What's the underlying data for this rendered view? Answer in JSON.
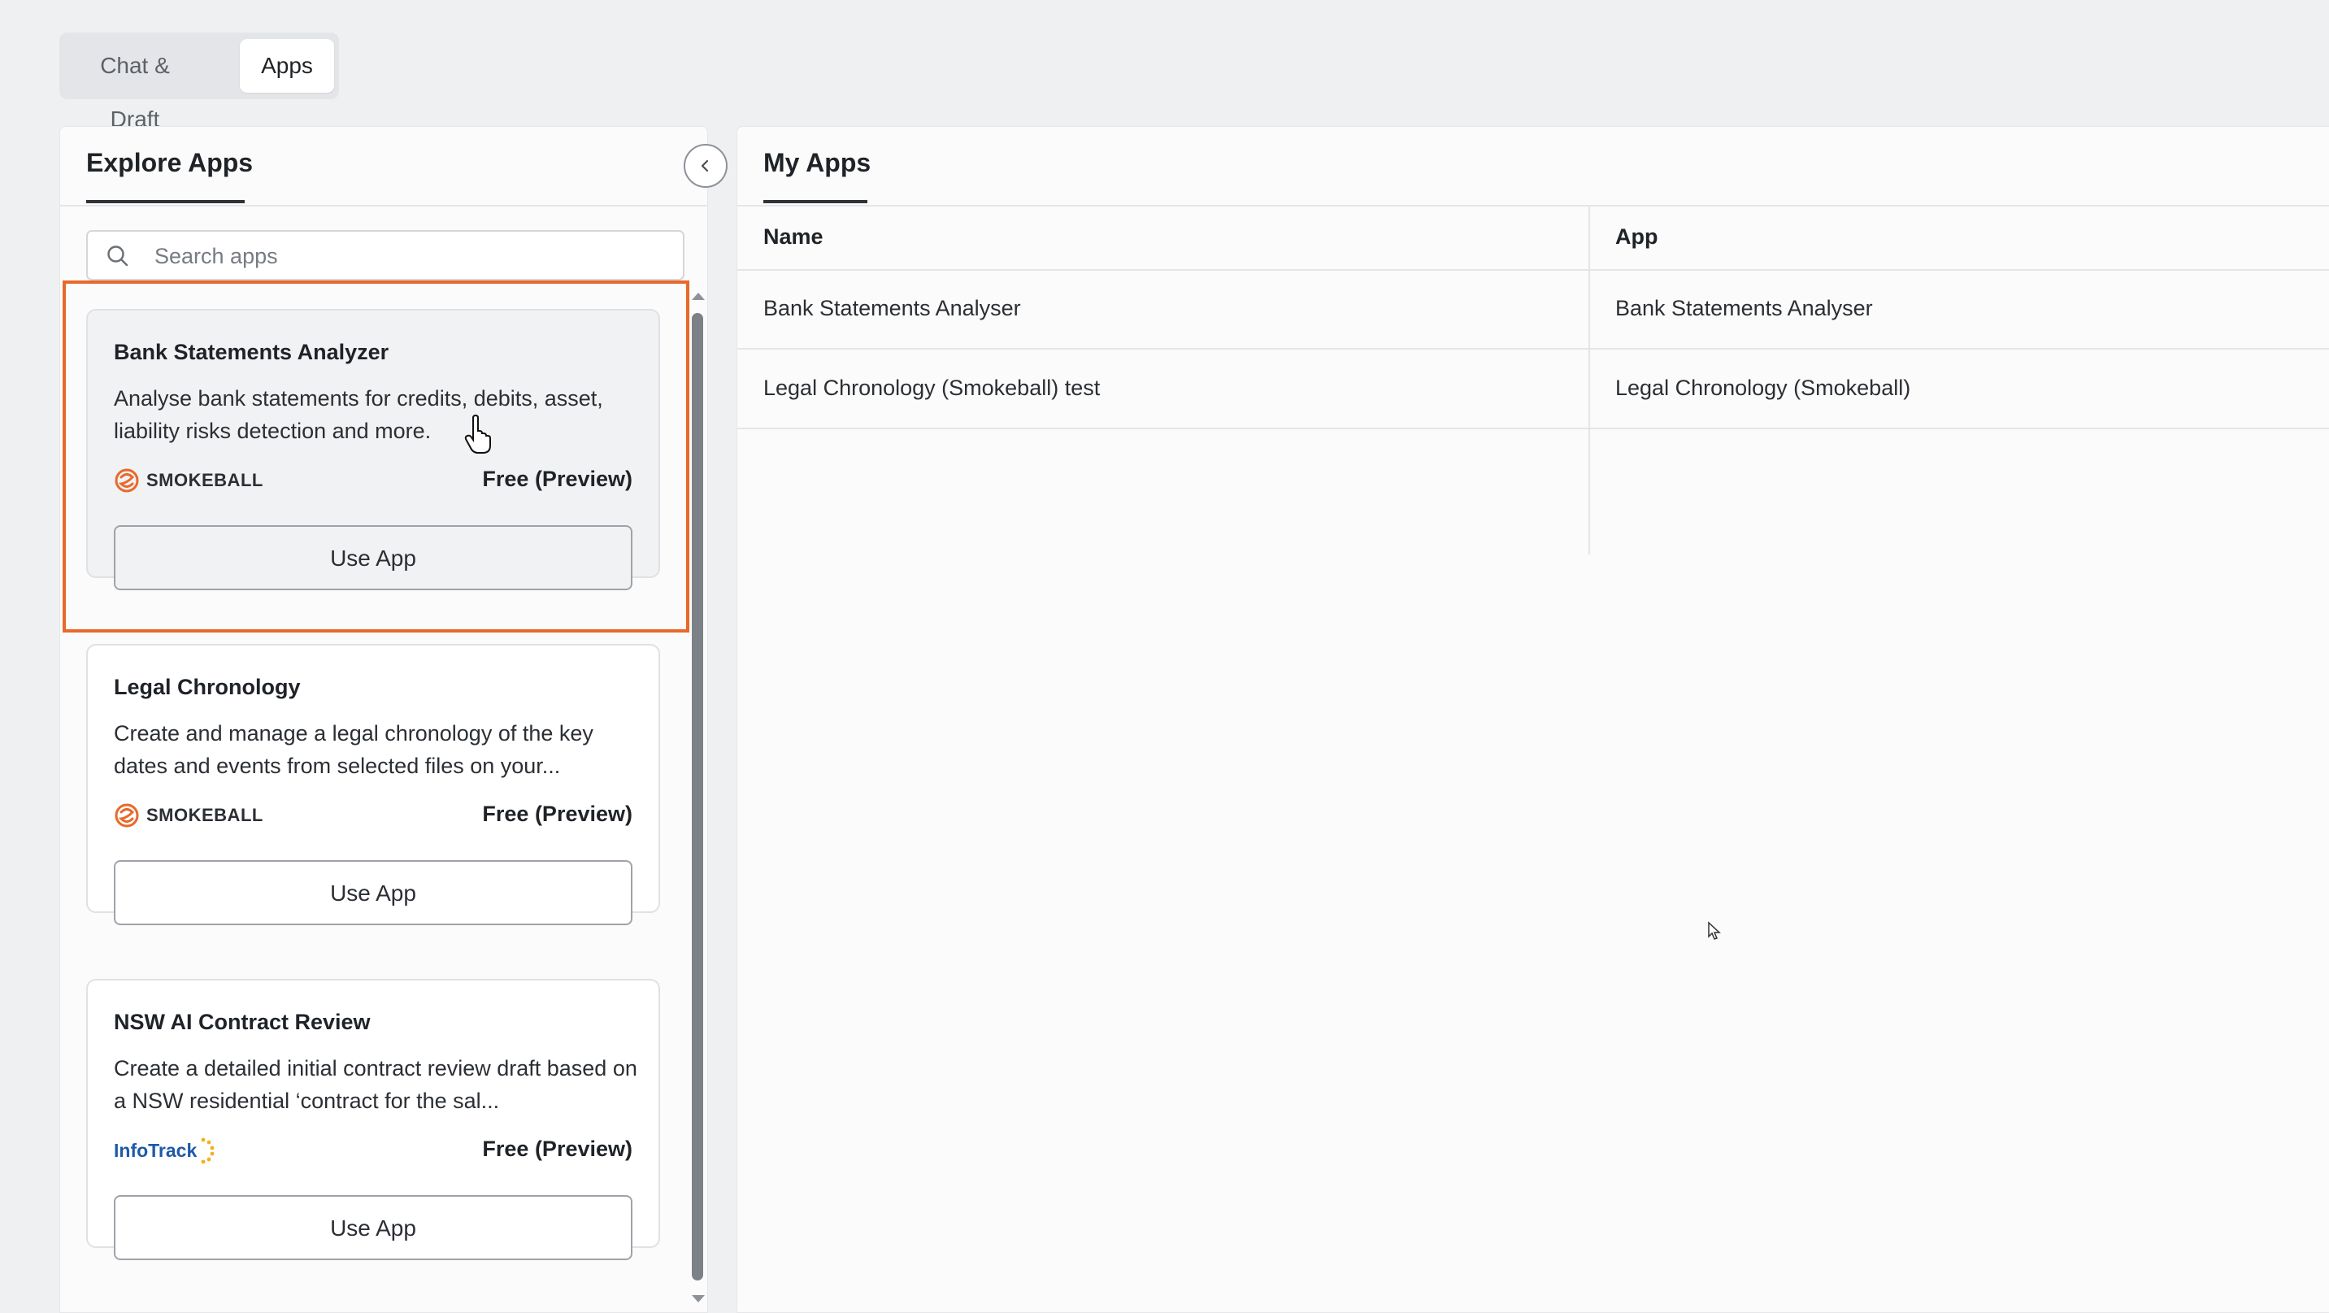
{
  "top_tabs": [
    {
      "label": "Chat & Draft",
      "active": false
    },
    {
      "label": "Apps",
      "active": true
    }
  ],
  "explore": {
    "title": "Explore Apps",
    "search_placeholder": "Search apps",
    "cards": [
      {
        "title": "Bank Statements Analyzer",
        "description": "Analyse bank statements for credits, debits, asset, liability risks detection and more.",
        "brand": "SMOKEBALL",
        "price": "Free (Preview)",
        "button": "Use App"
      },
      {
        "title": "Legal Chronology",
        "description": "Create and manage a legal chronology of the key dates and events from selected files on your...",
        "brand": "SMOKEBALL",
        "price": "Free (Preview)",
        "button": "Use App"
      },
      {
        "title": "NSW AI Contract Review",
        "description": "Create a detailed initial contract review draft based on a NSW residential ‘contract for the sal...",
        "brand": "InfoTrack",
        "price": "Free (Preview)",
        "button": "Use App"
      }
    ]
  },
  "my_apps": {
    "title": "My Apps",
    "columns": [
      "Name",
      "App"
    ],
    "rows": [
      [
        "Bank Statements Analyser",
        "Bank Statements Analyser"
      ],
      [
        "Legal Chronology (Smokeball) test",
        "Legal Chronology (Smokeball)"
      ]
    ]
  },
  "colors": {
    "highlight": "#e8692a",
    "smokeball_orange": "#e8692a",
    "infotrack_blue": "#1e5aa8",
    "infotrack_yellow": "#f2b01e"
  }
}
